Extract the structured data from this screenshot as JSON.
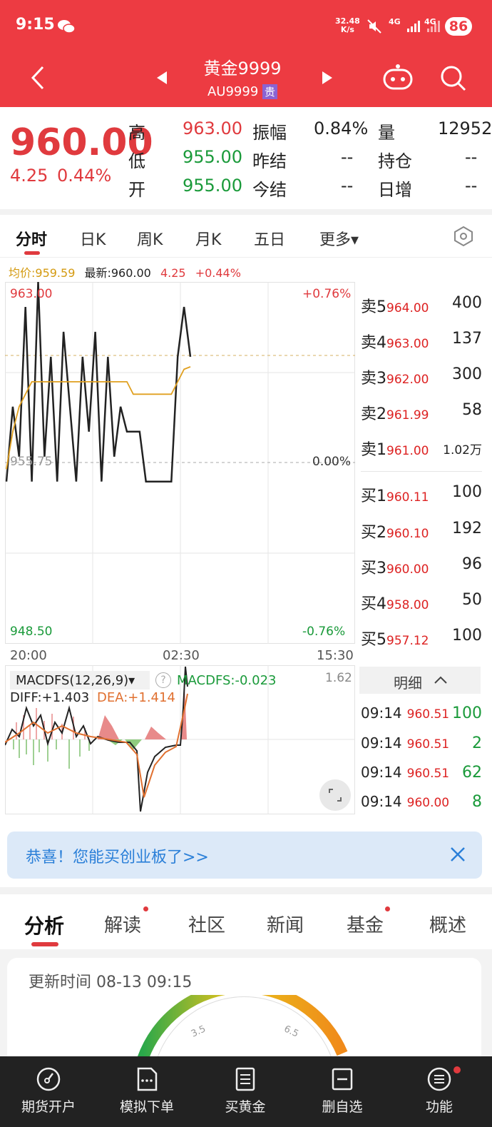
{
  "status": {
    "time": "9:15",
    "speed": "32.48",
    "speed_unit": "K/s",
    "net1": "4G",
    "net2": "4G",
    "battery": "86"
  },
  "header": {
    "title": "黄金9999",
    "code": "AU9999",
    "tag": "贵"
  },
  "quote": {
    "price": "960.00",
    "change": "4.25",
    "pct": "0.44%",
    "rows": [
      {
        "l1": "高",
        "v1": "963.00",
        "l2": "振幅",
        "v2": "0.84%",
        "l3": "量",
        "v3": "12952"
      },
      {
        "l1": "低",
        "v1": "955.00",
        "l2": "昨结",
        "v2": "--",
        "l3": "持仓",
        "v3": "--"
      },
      {
        "l1": "开",
        "v1": "955.00",
        "l2": "今结",
        "v2": "--",
        "l3": "日增",
        "v3": "--"
      }
    ]
  },
  "period_tabs": [
    "分时",
    "日K",
    "周K",
    "月K",
    "五日",
    "更多▾"
  ],
  "info_line": {
    "avg": "均价:959.59",
    "latest": "最新:960.00",
    "chg": "4.25",
    "pct": "+0.44%"
  },
  "chart": {
    "y_high": "963.00",
    "y_mid": "955.75",
    "y_low": "948.50",
    "pct_high": "+0.76%",
    "pct_mid": "0.00%",
    "pct_low": "-0.76%",
    "x_start": "20:00",
    "x_mid": "02:30",
    "x_end": "15:30"
  },
  "chart_data": {
    "type": "line",
    "title": "",
    "x_ticks": [
      "20:00",
      "02:30",
      "15:30"
    ],
    "ylim": [
      948.5,
      963.0
    ],
    "series": [
      {
        "name": "最新",
        "values": [
          955,
          958,
          956,
          962,
          955,
          963,
          956,
          960,
          955,
          961,
          958,
          955,
          960,
          957,
          961,
          955,
          960,
          956,
          958,
          957,
          957,
          957,
          955,
          955,
          955,
          955,
          955,
          960,
          962,
          960
        ]
      },
      {
        "name": "均价",
        "values": [
          955.5,
          957,
          958,
          958.5,
          959,
          959,
          959,
          959,
          959,
          959,
          959,
          959,
          959,
          959,
          959,
          959,
          959,
          959,
          959,
          959,
          958.5,
          958.5,
          958.5,
          958.5,
          958.5,
          958.5,
          958.5,
          959,
          959.5,
          959.6
        ]
      }
    ]
  },
  "macd": {
    "label": "MACDFS(12,26,9)▾",
    "help": "?",
    "value": "MACDFS:-0.023",
    "diff": "DIFF:+1.403",
    "dea": "DEA:+1.414",
    "scale": "1.62"
  },
  "orderbook": {
    "asks": [
      {
        "k": "卖5",
        "p": "964.00",
        "v": "400"
      },
      {
        "k": "卖4",
        "p": "963.00",
        "v": "137"
      },
      {
        "k": "卖3",
        "p": "962.00",
        "v": "300"
      },
      {
        "k": "卖2",
        "p": "961.99",
        "v": "58"
      },
      {
        "k": "卖1",
        "p": "961.00",
        "v": "1.02万"
      }
    ],
    "bids": [
      {
        "k": "买1",
        "p": "960.11",
        "v": "100"
      },
      {
        "k": "买2",
        "p": "960.10",
        "v": "192"
      },
      {
        "k": "买3",
        "p": "960.00",
        "v": "96"
      },
      {
        "k": "买4",
        "p": "958.00",
        "v": "50"
      },
      {
        "k": "买5",
        "p": "957.12",
        "v": "100"
      }
    ]
  },
  "detail": {
    "title": "明细",
    "rows": [
      {
        "t": "09:14",
        "p": "960.51",
        "v": "100"
      },
      {
        "t": "09:14",
        "p": "960.51",
        "v": "2"
      },
      {
        "t": "09:14",
        "p": "960.51",
        "v": "62"
      },
      {
        "t": "09:14",
        "p": "960.00",
        "v": "8"
      }
    ]
  },
  "banner": {
    "text": "恭喜！您能买创业板了>>"
  },
  "section_tabs": [
    "分析",
    "解读",
    "社区",
    "新闻",
    "基金",
    "概述"
  ],
  "analysis": {
    "update": "更新时间 08-13 09:15",
    "g1": "3.5",
    "g2": "6.5"
  },
  "bottom_nav": [
    "期货开户",
    "模拟下单",
    "买黄金",
    "删自选",
    "功能"
  ],
  "colors": {
    "brand": "#ed3b42",
    "up": "#e03a3e",
    "down": "#1a9a3a",
    "avg_line": "#e0a020",
    "dea": "#e07030"
  }
}
